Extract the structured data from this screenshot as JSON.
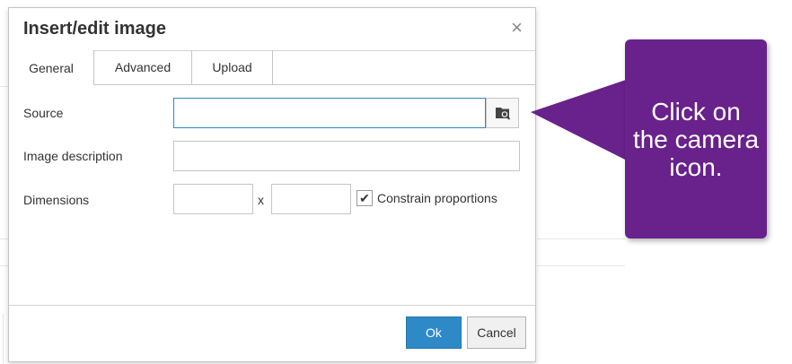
{
  "dialog": {
    "title": "Insert/edit image",
    "close_glyph": "×",
    "tabs": [
      {
        "label": "General",
        "active": true
      },
      {
        "label": "Advanced",
        "active": false
      },
      {
        "label": "Upload",
        "active": false
      }
    ],
    "fields": {
      "source_label": "Source",
      "source_value": "",
      "description_label": "Image description",
      "description_value": "",
      "dimensions_label": "Dimensions",
      "width_value": "",
      "height_value": "",
      "dimension_separator": "x",
      "constrain_label": "Constrain proportions",
      "constrain_checked": true,
      "check_glyph": "✔"
    },
    "buttons": {
      "ok": "Ok",
      "cancel": "Cancel"
    }
  },
  "callout": {
    "text": "Click on the camera icon."
  },
  "colors": {
    "callout_bg": "#69218c",
    "primary": "#2d8ac7"
  }
}
